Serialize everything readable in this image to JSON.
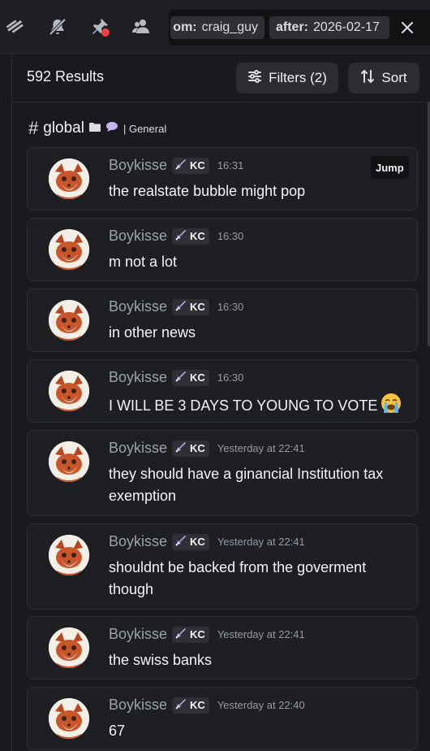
{
  "toolbar": {
    "icons": [
      "threads-icon",
      "mute-bell-icon",
      "pinned-icon",
      "members-icon"
    ],
    "search_chips": [
      {
        "key": "from:",
        "value": "craig_guy",
        "shown_key": "om:"
      },
      {
        "key": "after:",
        "value": "2026-02-17"
      }
    ]
  },
  "results": {
    "count_label": "592 Results",
    "filters_label": "Filters (2)",
    "sort_label": "Sort"
  },
  "channel": {
    "hash": "#",
    "name": "global",
    "subtitle": "| General"
  },
  "messages": [
    {
      "author": "Boykisse",
      "tag": "KC",
      "time": "16:31",
      "text": "the realstate bubble might pop",
      "jump": "Jump"
    },
    {
      "author": "Boykisse",
      "tag": "KC",
      "time": "16:30",
      "text": "m not a lot"
    },
    {
      "author": "Boykisse",
      "tag": "KC",
      "time": "16:30",
      "text": "in other news"
    },
    {
      "author": "Boykisse",
      "tag": "KC",
      "time": "16:30",
      "text": "I WILL BE 3 DAYS TO YOUNG TO VOTE",
      "emoji": "sob-emoji"
    },
    {
      "author": "Boykisse",
      "tag": "KC",
      "time": "Yesterday at 22:41",
      "text": "they should have a ginancial Institution tax exemption"
    },
    {
      "author": "Boykisse",
      "tag": "KC",
      "time": "Yesterday at 22:41",
      "text": "shouldnt be backed from the goverment though"
    },
    {
      "author": "Boykisse",
      "tag": "KC",
      "time": "Yesterday at 22:41",
      "text": "the swiss banks"
    },
    {
      "author": "Boykisse",
      "tag": "KC",
      "time": "Yesterday at 22:40",
      "text": "67"
    }
  ],
  "colors": {
    "background": "#1a1a1e",
    "card": "#1e1f22",
    "author": "#9aa4a8",
    "notification_dot": "#f23f43"
  }
}
